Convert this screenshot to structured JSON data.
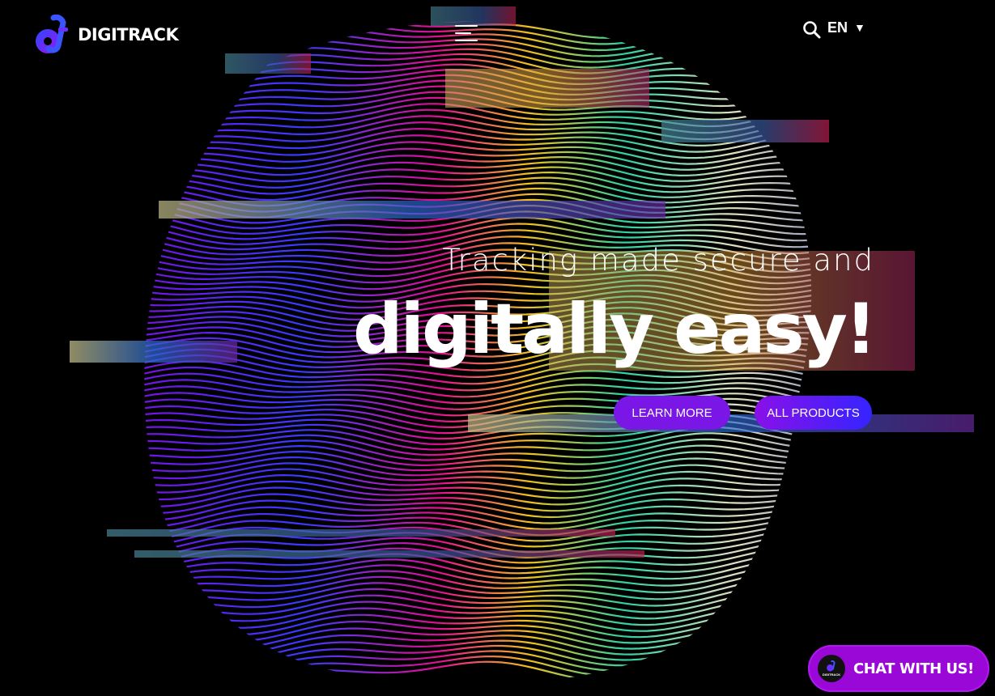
{
  "header": {
    "logo_text": "DIGITRACK",
    "menu_icon": "hamburger-menu-icon",
    "search_icon": "search-icon",
    "language": {
      "selected": "EN",
      "caret_icon": "caret-down-icon"
    }
  },
  "hero": {
    "headline_small": "Tracking made secure and",
    "headline_big": "digitally easy!",
    "buttons": {
      "learn_more": "LEARN MORE",
      "all_products": "ALL PRODUCTS"
    }
  },
  "chat_widget": {
    "label": "CHAT WITH US!",
    "avatar_text": "DIGITRACK"
  },
  "colors": {
    "background": "#000000",
    "accent_purple": "#7a17e6",
    "accent_blue": "#3524ff",
    "chat_purple": "#9a08d8"
  }
}
